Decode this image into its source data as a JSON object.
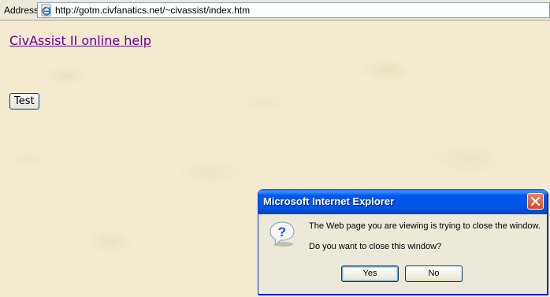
{
  "address_bar": {
    "label": "Address",
    "url": "http://gotm.civfanatics.net/~civassist/index.htm",
    "icon": "ie-page-icon"
  },
  "page": {
    "link_text": "CivAssist II online help",
    "link_color": "#660099",
    "button_label": "Test",
    "background": "#f3ead0"
  },
  "dialog": {
    "title": "Microsoft Internet Explorer",
    "message": "The Web page you are viewing is trying to close the window.",
    "question": "Do you want to close this window?",
    "icon": "question-icon",
    "yes_label": "Yes",
    "no_label": "No",
    "titlebar_color": "#0055e5",
    "close_icon": "close-icon"
  }
}
